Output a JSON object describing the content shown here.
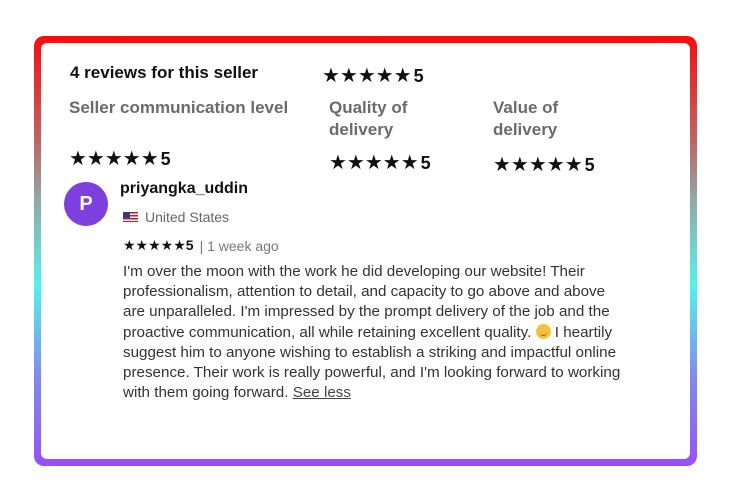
{
  "header": {
    "title": "4 reviews for this seller",
    "overall_stars": "★★★★★",
    "overall_rating": "5"
  },
  "categories": [
    {
      "label": "Seller communication level",
      "stars": "★★★★★",
      "rating": "5"
    },
    {
      "label": "Quality of delivery",
      "stars": "★★★★★",
      "rating": "5"
    },
    {
      "label": "Value of delivery",
      "stars": "★★★★★",
      "rating": "5"
    }
  ],
  "review": {
    "avatar_letter": "P",
    "username": "priyangka_uddin",
    "country": "United States",
    "stars": "★★★★★",
    "rating": "5",
    "time_ago": "| 1 week ago",
    "text_part1": "I'm over the moon with the work he did developing our website! Their professionalism, attention to detail, and capacity to go above and above are unparalleled. I'm impressed by the prompt delivery of the job and the proactive communication, all while retaining excellent quality.",
    "text_part2": " I heartily suggest him to anyone wishing to establish a striking and impactful online presence. Their work is really powerful, and I'm looking forward to working with them going forward.",
    "see_less": "See less"
  },
  "colors": {
    "avatar": "#7e3fe0",
    "border_top": "#ff0a0a",
    "border_mid": "#4ff5ee",
    "border_bottom": "#9a4ef8"
  },
  "icons": [
    "star-icon",
    "us-flag-icon",
    "smiling-face-emoji"
  ]
}
